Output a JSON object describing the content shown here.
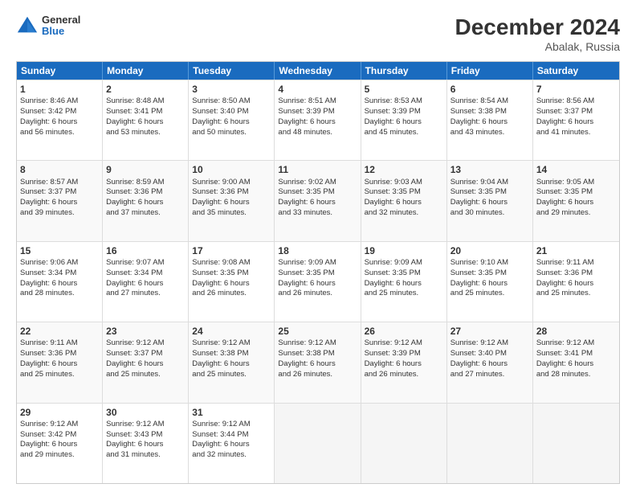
{
  "header": {
    "logo": {
      "general": "General",
      "blue": "Blue"
    },
    "title": "December 2024",
    "subtitle": "Abalak, Russia"
  },
  "days": [
    "Sunday",
    "Monday",
    "Tuesday",
    "Wednesday",
    "Thursday",
    "Friday",
    "Saturday"
  ],
  "weeks": [
    [
      {
        "day": "1",
        "info": "Sunrise: 8:46 AM\nSunset: 3:42 PM\nDaylight: 6 hours\nand 56 minutes."
      },
      {
        "day": "2",
        "info": "Sunrise: 8:48 AM\nSunset: 3:41 PM\nDaylight: 6 hours\nand 53 minutes."
      },
      {
        "day": "3",
        "info": "Sunrise: 8:50 AM\nSunset: 3:40 PM\nDaylight: 6 hours\nand 50 minutes."
      },
      {
        "day": "4",
        "info": "Sunrise: 8:51 AM\nSunset: 3:39 PM\nDaylight: 6 hours\nand 48 minutes."
      },
      {
        "day": "5",
        "info": "Sunrise: 8:53 AM\nSunset: 3:39 PM\nDaylight: 6 hours\nand 45 minutes."
      },
      {
        "day": "6",
        "info": "Sunrise: 8:54 AM\nSunset: 3:38 PM\nDaylight: 6 hours\nand 43 minutes."
      },
      {
        "day": "7",
        "info": "Sunrise: 8:56 AM\nSunset: 3:37 PM\nDaylight: 6 hours\nand 41 minutes."
      }
    ],
    [
      {
        "day": "8",
        "info": "Sunrise: 8:57 AM\nSunset: 3:37 PM\nDaylight: 6 hours\nand 39 minutes."
      },
      {
        "day": "9",
        "info": "Sunrise: 8:59 AM\nSunset: 3:36 PM\nDaylight: 6 hours\nand 37 minutes."
      },
      {
        "day": "10",
        "info": "Sunrise: 9:00 AM\nSunset: 3:36 PM\nDaylight: 6 hours\nand 35 minutes."
      },
      {
        "day": "11",
        "info": "Sunrise: 9:02 AM\nSunset: 3:35 PM\nDaylight: 6 hours\nand 33 minutes."
      },
      {
        "day": "12",
        "info": "Sunrise: 9:03 AM\nSunset: 3:35 PM\nDaylight: 6 hours\nand 32 minutes."
      },
      {
        "day": "13",
        "info": "Sunrise: 9:04 AM\nSunset: 3:35 PM\nDaylight: 6 hours\nand 30 minutes."
      },
      {
        "day": "14",
        "info": "Sunrise: 9:05 AM\nSunset: 3:35 PM\nDaylight: 6 hours\nand 29 minutes."
      }
    ],
    [
      {
        "day": "15",
        "info": "Sunrise: 9:06 AM\nSunset: 3:34 PM\nDaylight: 6 hours\nand 28 minutes."
      },
      {
        "day": "16",
        "info": "Sunrise: 9:07 AM\nSunset: 3:34 PM\nDaylight: 6 hours\nand 27 minutes."
      },
      {
        "day": "17",
        "info": "Sunrise: 9:08 AM\nSunset: 3:35 PM\nDaylight: 6 hours\nand 26 minutes."
      },
      {
        "day": "18",
        "info": "Sunrise: 9:09 AM\nSunset: 3:35 PM\nDaylight: 6 hours\nand 26 minutes."
      },
      {
        "day": "19",
        "info": "Sunrise: 9:09 AM\nSunset: 3:35 PM\nDaylight: 6 hours\nand 25 minutes."
      },
      {
        "day": "20",
        "info": "Sunrise: 9:10 AM\nSunset: 3:35 PM\nDaylight: 6 hours\nand 25 minutes."
      },
      {
        "day": "21",
        "info": "Sunrise: 9:11 AM\nSunset: 3:36 PM\nDaylight: 6 hours\nand 25 minutes."
      }
    ],
    [
      {
        "day": "22",
        "info": "Sunrise: 9:11 AM\nSunset: 3:36 PM\nDaylight: 6 hours\nand 25 minutes."
      },
      {
        "day": "23",
        "info": "Sunrise: 9:12 AM\nSunset: 3:37 PM\nDaylight: 6 hours\nand 25 minutes."
      },
      {
        "day": "24",
        "info": "Sunrise: 9:12 AM\nSunset: 3:38 PM\nDaylight: 6 hours\nand 25 minutes."
      },
      {
        "day": "25",
        "info": "Sunrise: 9:12 AM\nSunset: 3:38 PM\nDaylight: 6 hours\nand 26 minutes."
      },
      {
        "day": "26",
        "info": "Sunrise: 9:12 AM\nSunset: 3:39 PM\nDaylight: 6 hours\nand 26 minutes."
      },
      {
        "day": "27",
        "info": "Sunrise: 9:12 AM\nSunset: 3:40 PM\nDaylight: 6 hours\nand 27 minutes."
      },
      {
        "day": "28",
        "info": "Sunrise: 9:12 AM\nSunset: 3:41 PM\nDaylight: 6 hours\nand 28 minutes."
      }
    ],
    [
      {
        "day": "29",
        "info": "Sunrise: 9:12 AM\nSunset: 3:42 PM\nDaylight: 6 hours\nand 29 minutes."
      },
      {
        "day": "30",
        "info": "Sunrise: 9:12 AM\nSunset: 3:43 PM\nDaylight: 6 hours\nand 31 minutes."
      },
      {
        "day": "31",
        "info": "Sunrise: 9:12 AM\nSunset: 3:44 PM\nDaylight: 6 hours\nand 32 minutes."
      },
      {
        "day": "",
        "info": ""
      },
      {
        "day": "",
        "info": ""
      },
      {
        "day": "",
        "info": ""
      },
      {
        "day": "",
        "info": ""
      }
    ]
  ]
}
